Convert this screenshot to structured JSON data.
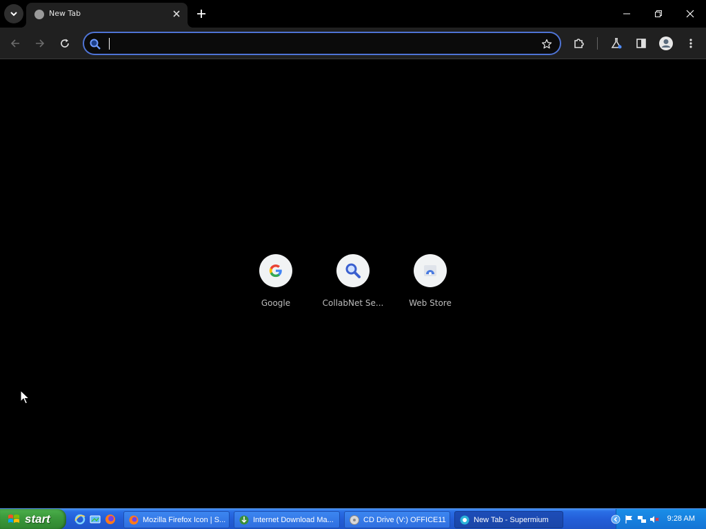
{
  "tabs": [
    {
      "title": "New Tab",
      "favicon": "globe-icon",
      "active": true
    }
  ],
  "window_controls": [
    "minimize-icon",
    "restore-icon",
    "close-icon"
  ],
  "toolbar": {
    "buttons": [
      "back-icon",
      "forward-icon",
      "reload-icon"
    ],
    "omnibox": {
      "value": "",
      "placeholder": ""
    },
    "right_buttons": [
      "extensions-icon",
      "labs-icon",
      "side-panel-icon",
      "profile-icon",
      "menu-icon"
    ]
  },
  "shortcuts": [
    {
      "label": "Google",
      "icon": "google-g-icon"
    },
    {
      "label": "CollabNet Se...",
      "icon": "search-magnifier-icon"
    },
    {
      "label": "Web Store",
      "icon": "web-store-icon"
    }
  ],
  "taskbar": {
    "start_label": "start",
    "quick_launch": [
      "internet-explorer-icon",
      "show-desktop-icon",
      "firefox-icon"
    ],
    "tasks": [
      {
        "label": "Mozilla Firefox Icon | S...",
        "icon": "firefox-icon",
        "active": false
      },
      {
        "label": "Internet Download Ma...",
        "icon": "download-manager-icon",
        "active": false
      },
      {
        "label": "CD Drive (V:) OFFICE11",
        "icon": "cd-drive-icon",
        "active": false
      },
      {
        "label": "New Tab - Supermium",
        "icon": "browser-icon",
        "active": true
      }
    ],
    "clock": "9:28 AM"
  },
  "colors": {
    "omnibox_border": "#4f74d6",
    "taskbar_blue": "#235ed8",
    "start_green": "#3c9a3c"
  }
}
